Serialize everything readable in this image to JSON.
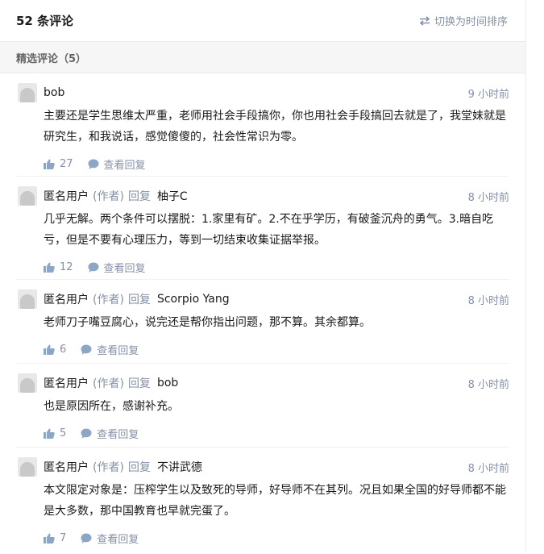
{
  "header": {
    "count_title": "52 条评论",
    "sort_label": "切换为时间排序"
  },
  "section": {
    "label": "精选评论（5）"
  },
  "colors": {
    "meta": "#8590a6",
    "text": "#1a1a1a",
    "section_bg": "#f6f6f6"
  },
  "comments": [
    {
      "author": "bob",
      "role": "",
      "reply_word": "",
      "reply_to": "",
      "time": "9 小时前",
      "text": "主要还是学生思维太严重，老师用社会手段搞你，你也用社会手段搞回去就是了，我堂妹就是研究生，和我说话，感觉傻傻的，社会性常识为零。",
      "likes": "27",
      "view_replies": "查看回复"
    },
    {
      "author": "匿名用户",
      "role": "(作者)",
      "reply_word": "回复",
      "reply_to": "柚子C",
      "time": "8 小时前",
      "text": "几乎无解。两个条件可以摆脱：1.家里有矿。2.不在乎学历，有破釜沉舟的勇气。3.暗自吃亏，但是不要有心理压力，等到一切结束收集证据举报。",
      "likes": "12",
      "view_replies": "查看回复"
    },
    {
      "author": "匿名用户",
      "role": "(作者)",
      "reply_word": "回复",
      "reply_to": "Scorpio Yang",
      "time": "8 小时前",
      "text": "老师刀子嘴豆腐心，说完还是帮你指出问题，那不算。其余都算。",
      "likes": "6",
      "view_replies": "查看回复"
    },
    {
      "author": "匿名用户",
      "role": "(作者)",
      "reply_word": "回复",
      "reply_to": "bob",
      "time": "8 小时前",
      "text": "也是原因所在，感谢补充。",
      "likes": "5",
      "view_replies": "查看回复"
    },
    {
      "author": "匿名用户",
      "role": "(作者)",
      "reply_word": "回复",
      "reply_to": "不讲武德",
      "time": "8 小时前",
      "text": "本文限定对象是：压榨学生以及致死的导师，好导师不在其列。况且如果全国的好导师都不能是大多数，那中国教育也早就完蛋了。",
      "likes": "7",
      "view_replies": "查看回复"
    }
  ]
}
